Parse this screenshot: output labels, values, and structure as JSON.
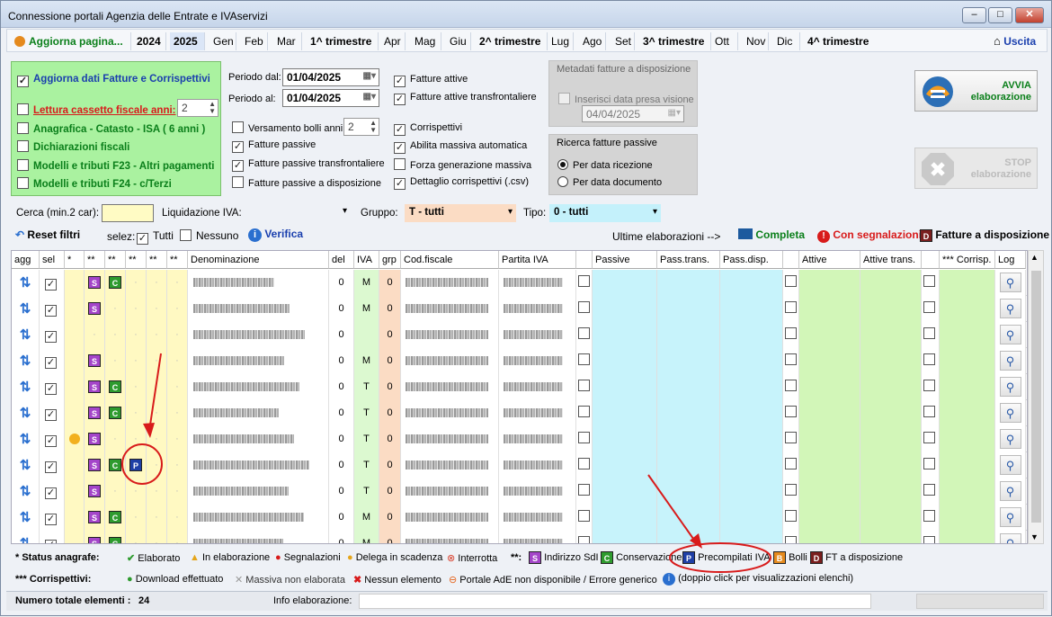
{
  "window": {
    "title": "Connessione portali Agenzia delle Entrate e IVAservizi",
    "min": "–",
    "max": "□",
    "close": "✕"
  },
  "toolbar": {
    "refresh_label": "Aggiorna pagina...",
    "years": [
      "2024",
      "2025"
    ],
    "periods": [
      "Gen",
      "Feb",
      "Mar",
      "1^ trimestre",
      "Apr",
      "Mag",
      "Giu",
      "2^ trimestre",
      "Lug",
      "Ago",
      "Set",
      "3^ trimestre",
      "Ott",
      "Nov",
      "Dic",
      "4^ trimestre"
    ],
    "exit_label": "Uscita"
  },
  "options_green": {
    "items": [
      {
        "label": "Aggiorna dati Fatture e Corrispettivi",
        "checked": true
      },
      {
        "label": "Lettura cassetto fiscale anni:",
        "checked": false,
        "spin": "2"
      },
      {
        "label": "Anagrafica - Catasto - ISA ( 6 anni )",
        "checked": false
      },
      {
        "label": "Dichiarazioni fiscali",
        "checked": false
      },
      {
        "label": "Modelli e tributi F23 - Altri pagamenti",
        "checked": false
      },
      {
        "label": "Modelli e tributi F24 - c/Terzi",
        "checked": false
      }
    ]
  },
  "period": {
    "from_label": "Periodo dal:",
    "from_value": "01/04/2025",
    "to_label": "Periodo al:",
    "to_value": "01/04/2025"
  },
  "options_mid": {
    "bolli": {
      "label": "Versamento bolli anni:",
      "spin": "2",
      "checked": false
    },
    "left": [
      {
        "label": "Fatture passive",
        "checked": true
      },
      {
        "label": "Fatture passive transfrontaliere",
        "checked": true
      },
      {
        "label": "Fatture passive a disposizione",
        "checked": false
      }
    ],
    "right": [
      {
        "label": "Fatture attive",
        "checked": true
      },
      {
        "label": "Fatture attive transfrontaliere",
        "checked": true
      },
      {
        "label": "Corrispettivi",
        "checked": true
      },
      {
        "label": "Abilita massiva automatica",
        "checked": true
      },
      {
        "label": "Forza generazione massiva",
        "checked": false
      },
      {
        "label": "Dettaglio corrispettivi (.csv)",
        "checked": true
      }
    ]
  },
  "metadata": {
    "title": "Metadati fatture a disposizione",
    "checkbox_label": "Inserisci data presa visione",
    "date": "04/04/2025"
  },
  "search_mode": {
    "title": "Ricerca fatture passive",
    "opt1": "Per data ricezione",
    "opt2": "Per data documento"
  },
  "start_button": {
    "line1": "AVVIA",
    "line2": "elaborazione"
  },
  "stop_button": {
    "line1": "STOP",
    "line2": "elaborazione"
  },
  "filters": {
    "search_label": "Cerca (min.2 car):",
    "liquidazione_label": "Liquidazione IVA:",
    "gruppo_label": "Gruppo:",
    "gruppo_value": "T - tutti",
    "tipo_label": "Tipo:",
    "tipo_value": "0 - tutti"
  },
  "actions": {
    "reset": "Reset filtri",
    "selez": "selez:",
    "tutti": "Tutti",
    "nessuno": "Nessuno",
    "verifica": "Verifica",
    "ultime": "Ultime elaborazioni -->",
    "completa": "Completa",
    "segnalazioni": "Con segnalazioni",
    "disposizione": "Fatture a disposizione"
  },
  "grid": {
    "headers": [
      "agg",
      "sel",
      "*",
      "**",
      "**",
      "**",
      "**",
      "**",
      "Denominazione",
      "del",
      "IVA",
      "grp",
      "Cod.fiscale",
      "Partita IVA",
      "",
      "Passive",
      "Pass.trans.",
      "Pass.disp.",
      "",
      "Attive",
      "Attive trans.",
      "",
      "*** Corrisp.",
      "Log"
    ],
    "rows": [
      {
        "badges": [
          "S",
          "C"
        ],
        "alert": false,
        "del": "0",
        "iva": "M",
        "grp": "0"
      },
      {
        "badges": [
          "S"
        ],
        "alert": false,
        "del": "0",
        "iva": "M",
        "grp": "0"
      },
      {
        "badges": [],
        "alert": false,
        "del": "0",
        "iva": "",
        "grp": "0"
      },
      {
        "badges": [
          "S"
        ],
        "alert": false,
        "del": "0",
        "iva": "M",
        "grp": "0"
      },
      {
        "badges": [
          "S",
          "C"
        ],
        "alert": false,
        "del": "0",
        "iva": "T",
        "grp": "0"
      },
      {
        "badges": [
          "S",
          "C"
        ],
        "alert": false,
        "del": "0",
        "iva": "T",
        "grp": "0"
      },
      {
        "badges": [
          "S"
        ],
        "alert": true,
        "del": "0",
        "iva": "T",
        "grp": "0"
      },
      {
        "badges": [
          "S",
          "C",
          "P"
        ],
        "alert": false,
        "del": "0",
        "iva": "T",
        "grp": "0"
      },
      {
        "badges": [
          "S"
        ],
        "alert": false,
        "del": "0",
        "iva": "T",
        "grp": "0"
      },
      {
        "badges": [
          "S",
          "C"
        ],
        "alert": false,
        "del": "0",
        "iva": "M",
        "grp": "0"
      },
      {
        "badges": [
          "S",
          "C"
        ],
        "alert": false,
        "del": "0",
        "iva": "M",
        "grp": "0"
      }
    ]
  },
  "legend": {
    "status_label": "* Status anagrafe:",
    "status_items": [
      "Elaborato",
      "In elaborazione",
      "Segnalazioni",
      "Delega in scadenza",
      "Interrotta"
    ],
    "double_star": "**:",
    "badge_items": [
      "Indirizzo SdI",
      "Conservazione",
      "Precompilati IVA",
      "Bolli",
      "FT a disposizione"
    ],
    "corr_label": "*** Corrispettivi:",
    "corr_items": [
      "Download effettuato",
      "Massiva non elaborata",
      "Nessun elemento",
      "Portale AdE non disponibile / Errore generico",
      "(doppio click per visualizzazioni elenchi)"
    ]
  },
  "status": {
    "total_label": "Numero totale elementi :",
    "total_value": "24",
    "info_label": "Info elaborazione:"
  },
  "colors": {
    "green_panel": "#aaf2a0",
    "passive_bg": "#c7f3fb",
    "active_bg": "#d2f6b8",
    "accent_red": "#d81b1b"
  }
}
